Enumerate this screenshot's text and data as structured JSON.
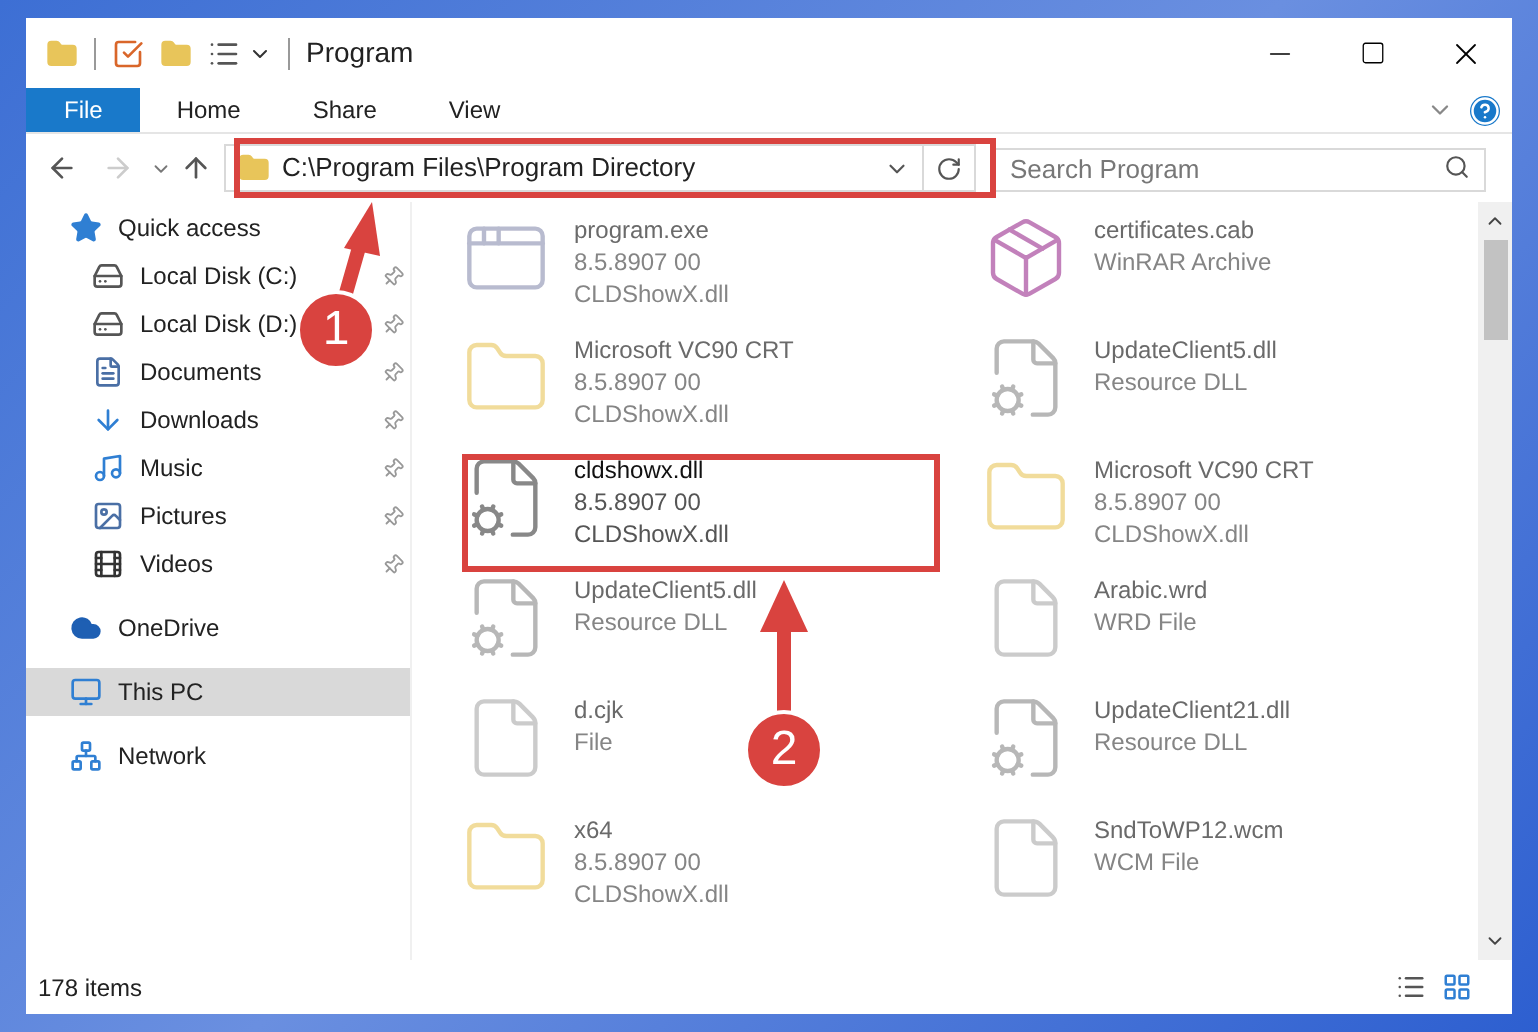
{
  "window": {
    "title": "Program"
  },
  "ribbon_tabs": [
    {
      "label": "File",
      "selected": true
    },
    {
      "label": "Home",
      "selected": false
    },
    {
      "label": "Share",
      "selected": false
    },
    {
      "label": "View",
      "selected": false
    }
  ],
  "address_bar": {
    "path": "C:\\Program Files\\Program Directory"
  },
  "search": {
    "placeholder": "Search Program"
  },
  "sidebar": {
    "items": [
      {
        "label": "Quick access",
        "kind": "quick",
        "pinned": false,
        "selected": false,
        "children": [
          {
            "label": "Local Disk (C:)",
            "kind": "drive-c",
            "pinned": true,
            "selected": false
          },
          {
            "label": "Local Disk (D:)",
            "kind": "drive",
            "pinned": true,
            "selected": false
          },
          {
            "label": "Documents",
            "kind": "documents",
            "pinned": true,
            "selected": false
          },
          {
            "label": "Downloads",
            "kind": "downloads",
            "pinned": true,
            "selected": false
          },
          {
            "label": "Music",
            "kind": "music",
            "pinned": true,
            "selected": false
          },
          {
            "label": "Pictures",
            "kind": "pictures",
            "pinned": true,
            "selected": false
          },
          {
            "label": "Videos",
            "kind": "videos",
            "pinned": true,
            "selected": false
          }
        ]
      },
      {
        "label": "OneDrive",
        "kind": "onedrive",
        "pinned": false,
        "selected": false
      },
      {
        "label": "This PC",
        "kind": "pc",
        "pinned": false,
        "selected": true
      },
      {
        "label": "Network",
        "kind": "network",
        "pinned": false,
        "selected": false
      }
    ]
  },
  "files": [
    {
      "kind": "exe",
      "blurred": true,
      "lines": [
        "program.exe",
        "8.5.8907 00",
        "CLDShowX.dll"
      ]
    },
    {
      "kind": "archive",
      "blurred": true,
      "lines": [
        "certificates.cab",
        "WinRAR Archive"
      ]
    },
    {
      "kind": "folder",
      "blurred": true,
      "lines": [
        "Microsoft VC90 CRT",
        "8.5.8907 00",
        "CLDShowX.dll"
      ]
    },
    {
      "kind": "dll",
      "blurred": true,
      "lines": [
        "UpdateClient5.dll",
        "Resource DLL"
      ]
    },
    {
      "kind": "dll",
      "blurred": false,
      "lines": [
        "cldshowx.dll",
        "8.5.8907 00",
        "CLDShowX.dll"
      ]
    },
    {
      "kind": "folder",
      "blurred": true,
      "lines": [
        "Microsoft VC90 CRT",
        "8.5.8907 00",
        "CLDShowX.dll"
      ]
    },
    {
      "kind": "dll",
      "blurred": true,
      "lines": [
        "UpdateClient5.dll",
        "Resource DLL"
      ]
    },
    {
      "kind": "file",
      "blurred": true,
      "lines": [
        "Arabic.wrd",
        "WRD File"
      ]
    },
    {
      "kind": "file",
      "blurred": true,
      "lines": [
        "d.cjk",
        "File"
      ]
    },
    {
      "kind": "dll",
      "blurred": true,
      "lines": [
        "UpdateClient21.dll",
        "Resource DLL"
      ]
    },
    {
      "kind": "folder",
      "blurred": true,
      "lines": [
        "x64",
        "8.5.8907 00",
        "CLDShowX.dll"
      ]
    },
    {
      "kind": "file",
      "blurred": true,
      "lines": [
        "SndToWP12.wcm",
        "WCM File"
      ]
    }
  ],
  "status_bar": {
    "count": "178 items"
  },
  "annotations": [
    {
      "label": "1"
    },
    {
      "label": "2"
    }
  ]
}
